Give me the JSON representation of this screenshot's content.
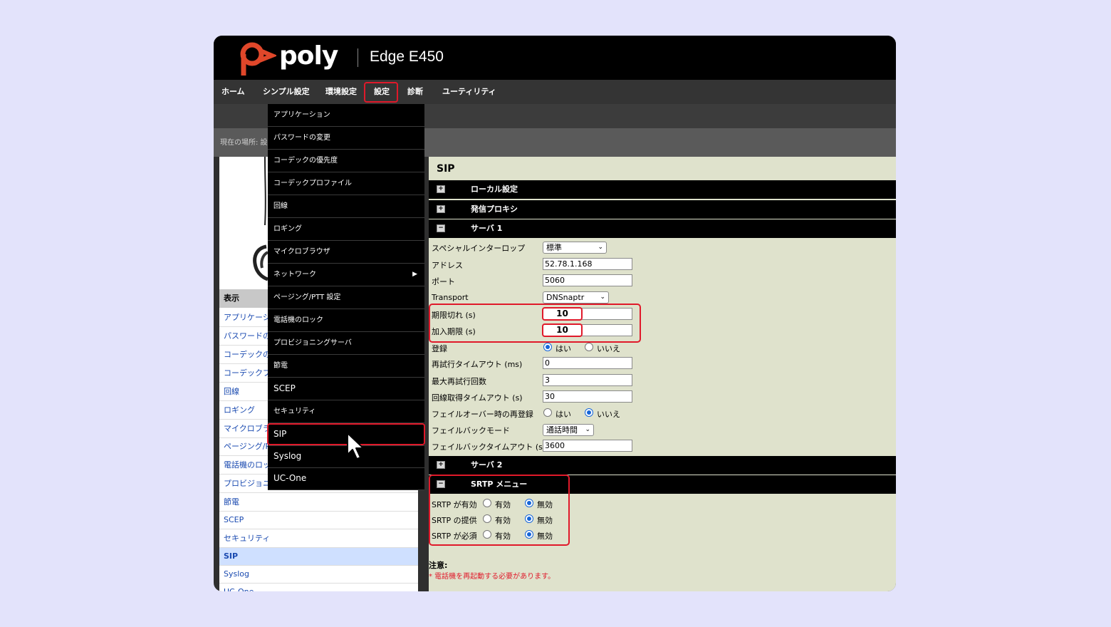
{
  "header": {
    "logo_text": "poly",
    "product_title": "Edge E450",
    "brand_color": "#e0472a"
  },
  "nav": {
    "items": [
      "ホーム",
      "シンプル設定",
      "環境設定",
      "設定",
      "診断",
      "ユーティリティ"
    ],
    "active_index": 3
  },
  "breadcrumb": "現在の場所: 設",
  "left_nav": {
    "heading": "表示",
    "items": [
      "アプリケーシ",
      "パスワードの",
      "コーデックの",
      "コーデックプ",
      "回線",
      "ロギング",
      "マイクロブラ",
      "ページング/P",
      "電話機のロッ",
      "プロビジョニ",
      "節電",
      "SCEP",
      "セキュリティ",
      "SIP",
      "Syslog",
      "UC-One"
    ],
    "active_index": 13
  },
  "dropdown": {
    "items": [
      "アプリケーション",
      "パスワードの変更",
      "コーデックの優先度",
      "コーデックプロファイル",
      "回線",
      "ロギング",
      "マイクロブラウザ",
      "ネットワーク",
      "ページング/PTT 設定",
      "電話機のロック",
      "プロビジョニングサーバ",
      "節電",
      "SCEP",
      "セキュリティ",
      "SIP",
      "Syslog",
      "UC-One"
    ],
    "submenu_arrow": "▶",
    "highlighted_index": 14
  },
  "main": {
    "title": "SIP",
    "sections": {
      "local": "ローカル設定",
      "outbound_proxy": "発信プロキシ",
      "server1": "サーバ 1",
      "server2": "サーバ 2",
      "srtp": "SRTP メニュー"
    },
    "expander_plus": "+",
    "expander_minus": "−",
    "fields": {
      "special_interop": {
        "label": "スペシャルインターロップ",
        "value": "標準"
      },
      "address": {
        "label": "アドレス",
        "value": "52.78.1.168"
      },
      "port": {
        "label": "ポート",
        "value": "5060"
      },
      "transport": {
        "label": "Transport",
        "value": "DNSnaptr"
      },
      "expires": {
        "label": "期限切れ (s)",
        "value": "10"
      },
      "subscribe_expires": {
        "label": "加入期限 (s)",
        "value": "10"
      },
      "register": {
        "label": "登録",
        "yes": "はい",
        "no": "いいえ",
        "selected": "yes"
      },
      "retry_timeout": {
        "label": "再試行タイムアウト (ms)",
        "value": "0"
      },
      "max_retries": {
        "label": "最大再試行回数",
        "value": "3"
      },
      "line_seize_timeout": {
        "label": "回線取得タイムアウト (s)",
        "value": "30"
      },
      "failover_reregister": {
        "label": "フェイルオーバー時の再登録",
        "yes": "はい",
        "no": "いいえ",
        "selected": "no"
      },
      "failback_mode": {
        "label": "フェイルバックモード",
        "value": "通話時間"
      },
      "failback_timeout": {
        "label": "フェイルバックタイムアウト (s)",
        "value": "3600"
      }
    },
    "srtp": {
      "rows": [
        {
          "label": "SRTP が有効",
          "on": "有効",
          "off": "無効",
          "selected": "off"
        },
        {
          "label": "SRTP の提供",
          "on": "有効",
          "off": "無効",
          "selected": "off"
        },
        {
          "label": "SRTP が必須",
          "on": "有効",
          "off": "無効",
          "selected": "off"
        }
      ]
    },
    "note_heading": "注意:",
    "note_text": "* 電話機を再起動する必要があります。"
  },
  "select_chevron": "⌄",
  "highlight_color": "#e0192a"
}
